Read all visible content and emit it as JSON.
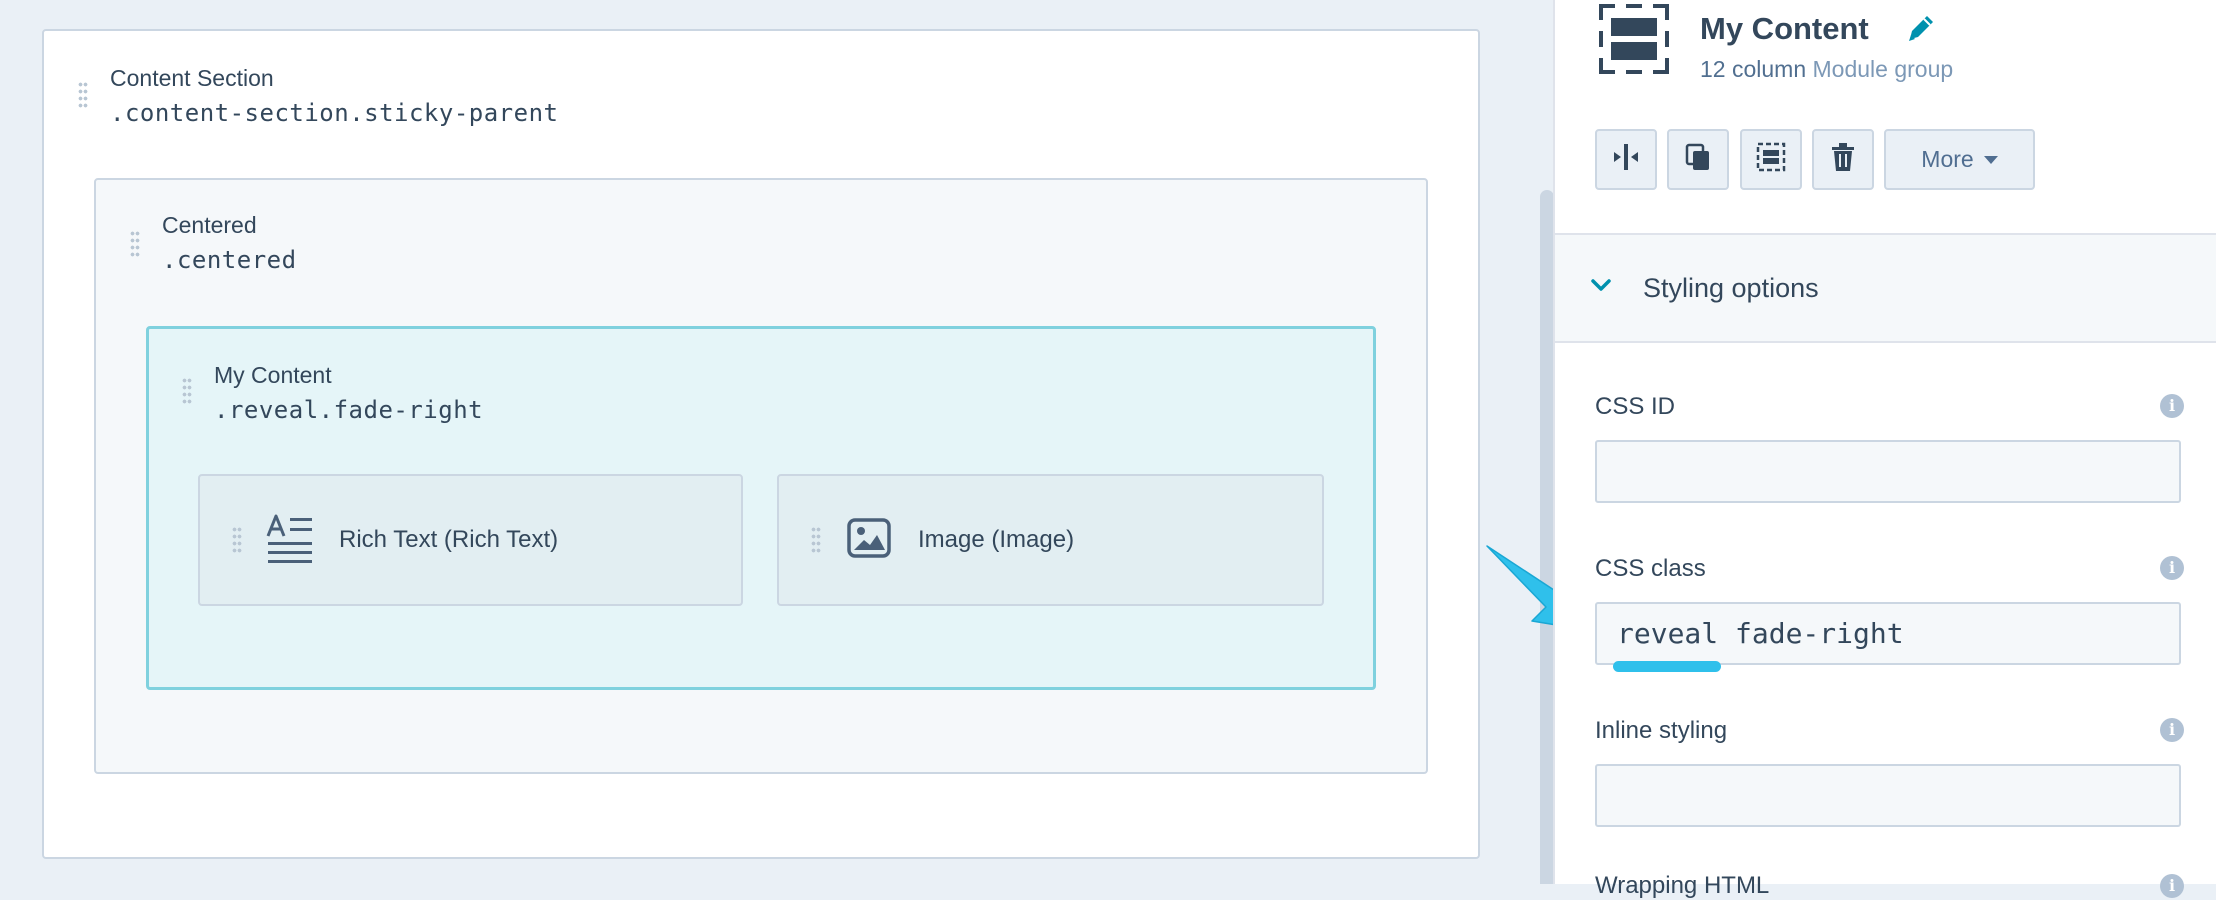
{
  "canvas": {
    "section": {
      "name": "Content Section",
      "css_class": ".content-section.sticky-parent"
    },
    "centered": {
      "name": "Centered",
      "css_class": ".centered"
    },
    "group": {
      "name": "My Content",
      "css_class": ".reveal.fade-right"
    },
    "modules": [
      {
        "label": "Rich Text (Rich Text)",
        "icon": "rich-text-icon"
      },
      {
        "label": "Image (Image)",
        "icon": "image-icon"
      }
    ]
  },
  "panel": {
    "title": "My Content",
    "subtitle_prefix": "12 column",
    "subtitle_link": "Module group",
    "toolbar": {
      "buttons": [
        {
          "name": "split-button",
          "icon": "split-icon"
        },
        {
          "name": "clone-button",
          "icon": "clone-icon"
        },
        {
          "name": "group-button",
          "icon": "group-icon"
        },
        {
          "name": "delete-button",
          "icon": "trash-icon"
        }
      ],
      "more_label": "More"
    },
    "styling": {
      "title": "Styling options",
      "css_id": {
        "label": "CSS ID",
        "value": ""
      },
      "css_class": {
        "label": "CSS class",
        "value": "reveal fade-right"
      },
      "inline_styling": {
        "label": "Inline styling",
        "value": ""
      },
      "next_label_partial": "Wrapping HTML"
    }
  },
  "colors": {
    "accent": "#00a4bd",
    "highlight_border": "#7fd1de",
    "arrow": "#2fc0eb",
    "text": "#33475b",
    "link": "#7c98b6"
  }
}
